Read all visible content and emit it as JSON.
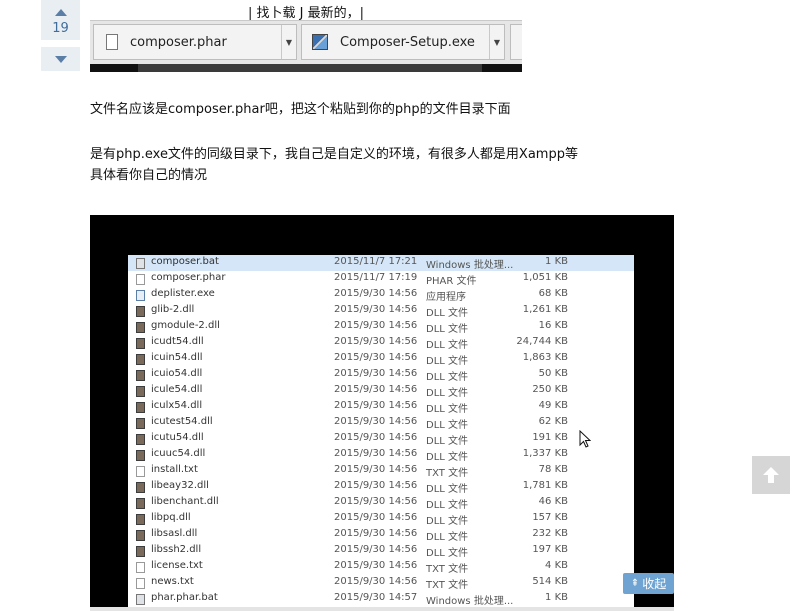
{
  "vote": {
    "count": "19"
  },
  "screenshot_top": {
    "caption": "| 找卜载 J 最新的，|",
    "downloads": [
      {
        "label": "composer.phar",
        "icon": "file-icon"
      },
      {
        "label": "Composer-Setup.exe",
        "icon": "installer-icon"
      }
    ]
  },
  "answer": {
    "line1": "文件名应该是composer.phar吧，把这个粘贴到你的php的文件目录下面",
    "line2": "是有php.exe文件的同级目录下，我自己是自定义的环境，有很多人都是用Xampp等",
    "line3": "具体看你自己的情况"
  },
  "explorer": {
    "files": [
      {
        "name": "composer.bat",
        "date": "2015/11/7 17:21",
        "type": "Windows 批处理...",
        "size": "1 KB",
        "icon": "bat"
      },
      {
        "name": "composer.phar",
        "date": "2015/11/7 17:19",
        "type": "PHAR 文件",
        "size": "1,051 KB",
        "icon": "doc"
      },
      {
        "name": "deplister.exe",
        "date": "2015/9/30 14:56",
        "type": "应用程序",
        "size": "68 KB",
        "icon": "exe"
      },
      {
        "name": "glib-2.dll",
        "date": "2015/9/30 14:56",
        "type": "DLL 文件",
        "size": "1,261 KB",
        "icon": "dll"
      },
      {
        "name": "gmodule-2.dll",
        "date": "2015/9/30 14:56",
        "type": "DLL 文件",
        "size": "16 KB",
        "icon": "dll"
      },
      {
        "name": "icudt54.dll",
        "date": "2015/9/30 14:56",
        "type": "DLL 文件",
        "size": "24,744 KB",
        "icon": "dll"
      },
      {
        "name": "icuin54.dll",
        "date": "2015/9/30 14:56",
        "type": "DLL 文件",
        "size": "1,863 KB",
        "icon": "dll"
      },
      {
        "name": "icuio54.dll",
        "date": "2015/9/30 14:56",
        "type": "DLL 文件",
        "size": "50 KB",
        "icon": "dll"
      },
      {
        "name": "icule54.dll",
        "date": "2015/9/30 14:56",
        "type": "DLL 文件",
        "size": "250 KB",
        "icon": "dll"
      },
      {
        "name": "iculx54.dll",
        "date": "2015/9/30 14:56",
        "type": "DLL 文件",
        "size": "49 KB",
        "icon": "dll"
      },
      {
        "name": "icutest54.dll",
        "date": "2015/9/30 14:56",
        "type": "DLL 文件",
        "size": "62 KB",
        "icon": "dll"
      },
      {
        "name": "icutu54.dll",
        "date": "2015/9/30 14:56",
        "type": "DLL 文件",
        "size": "191 KB",
        "icon": "dll"
      },
      {
        "name": "icuuc54.dll",
        "date": "2015/9/30 14:56",
        "type": "DLL 文件",
        "size": "1,337 KB",
        "icon": "dll"
      },
      {
        "name": "install.txt",
        "date": "2015/9/30 14:56",
        "type": "TXT 文件",
        "size": "78 KB",
        "icon": "doc"
      },
      {
        "name": "libeay32.dll",
        "date": "2015/9/30 14:56",
        "type": "DLL 文件",
        "size": "1,781 KB",
        "icon": "dll"
      },
      {
        "name": "libenchant.dll",
        "date": "2015/9/30 14:56",
        "type": "DLL 文件",
        "size": "46 KB",
        "icon": "dll"
      },
      {
        "name": "libpq.dll",
        "date": "2015/9/30 14:56",
        "type": "DLL 文件",
        "size": "157 KB",
        "icon": "dll"
      },
      {
        "name": "libsasl.dll",
        "date": "2015/9/30 14:56",
        "type": "DLL 文件",
        "size": "232 KB",
        "icon": "dll"
      },
      {
        "name": "libssh2.dll",
        "date": "2015/9/30 14:56",
        "type": "DLL 文件",
        "size": "197 KB",
        "icon": "dll"
      },
      {
        "name": "license.txt",
        "date": "2015/9/30 14:56",
        "type": "TXT 文件",
        "size": "4 KB",
        "icon": "doc"
      },
      {
        "name": "news.txt",
        "date": "2015/9/30 14:56",
        "type": "TXT 文件",
        "size": "514 KB",
        "icon": "doc"
      },
      {
        "name": "phar.phar.bat",
        "date": "2015/9/30 14:57",
        "type": "Windows 批处理...",
        "size": "1 KB",
        "icon": "bat"
      }
    ]
  },
  "controls": {
    "collapse_label": "收起",
    "collapse_icon": "collapse-icon",
    "back_to_top_icon": "arrow-up-icon"
  }
}
